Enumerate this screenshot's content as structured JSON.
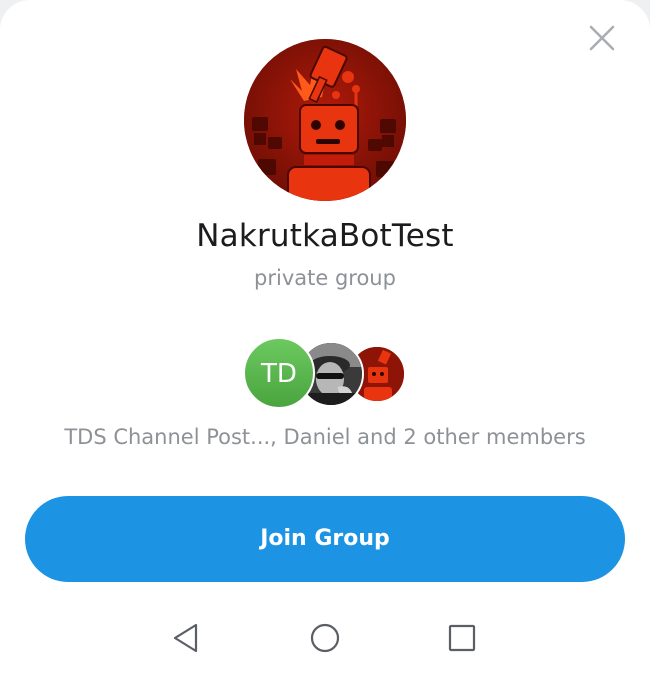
{
  "group": {
    "name": "NakrutkaBotTest",
    "type": "private group",
    "avatar_icon": "robot-avatar-icon"
  },
  "members": {
    "avatars": [
      {
        "initials": "TD",
        "color": "#5cb84f"
      },
      {
        "icon": "user-photo-icon"
      },
      {
        "icon": "robot-avatar-icon"
      }
    ],
    "summary": "TDS Channel Post..., Daniel and 2 other members"
  },
  "actions": {
    "join_label": "Join Group",
    "close_icon": "close-icon"
  },
  "navbar": {
    "back_icon": "back-triangle-icon",
    "home_icon": "home-circle-icon",
    "recent_icon": "recent-square-icon"
  },
  "colors": {
    "accent": "#1c93e3",
    "avatar_green": "#5cb84f",
    "avatar_red": "#d6230c"
  }
}
